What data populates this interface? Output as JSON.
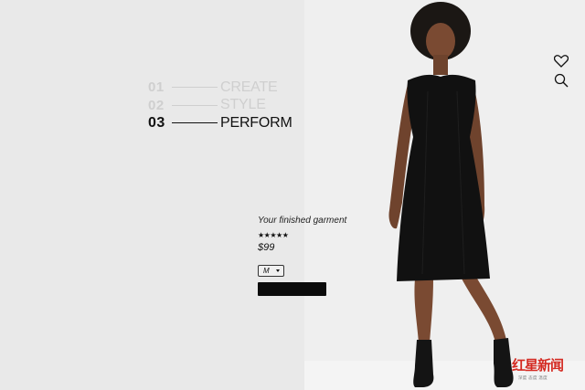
{
  "steps": [
    {
      "number": "01",
      "label": "CREATE",
      "active": false
    },
    {
      "number": "02",
      "label": "STYLE",
      "active": false
    },
    {
      "number": "03",
      "label": "PERFORM",
      "active": true
    }
  ],
  "product": {
    "title": "Your finished garment",
    "rating_stars": "★★★★★",
    "rating": 5,
    "price": "$99",
    "size": "M",
    "add_button_label": ""
  },
  "icons": {
    "wishlist": "heart-icon",
    "search": "search-icon"
  },
  "watermark": {
    "logo_text": "红星新闻",
    "subtitle": "深度 态度 温度"
  },
  "colors": {
    "background": "#e9e9e9",
    "panel": "#efefef",
    "text": "#111111",
    "muted": "#cfcfcf",
    "button": "#0b0b0b",
    "watermark_red": "#d42a22"
  }
}
